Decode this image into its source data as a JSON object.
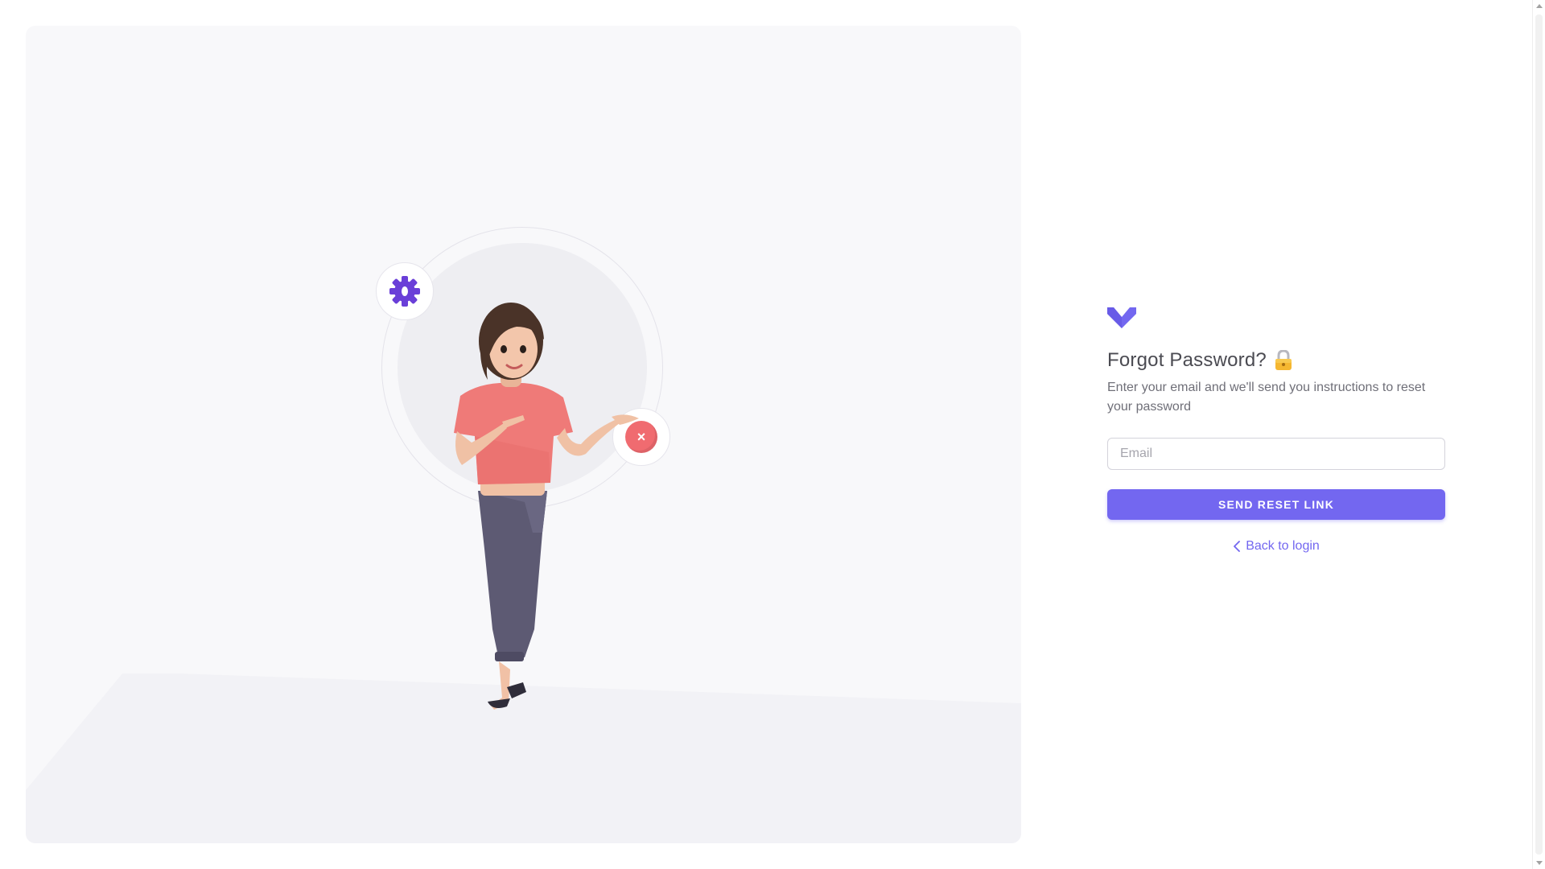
{
  "illustration": {
    "gear_icon": "gear-icon",
    "close_icon": "close-icon",
    "close_symbol": "×",
    "character": "woman-pointing-character"
  },
  "form": {
    "logo_icon": "brand-logo-icon",
    "title": "Forgot Password?",
    "title_icon": "lock-icon",
    "subtitle": "Enter your email and we'll send you instructions to reset your password",
    "email": {
      "placeholder": "Email",
      "value": ""
    },
    "submit_label": "SEND RESET LINK",
    "back_label": "Back to login",
    "back_icon": "chevron-left-icon"
  },
  "colors": {
    "primary": "#7367f0",
    "panel_background": "#f8f8fa",
    "heading": "#4b4b52",
    "body_text": "#6f6f78",
    "close_badge": "#f06b70"
  }
}
